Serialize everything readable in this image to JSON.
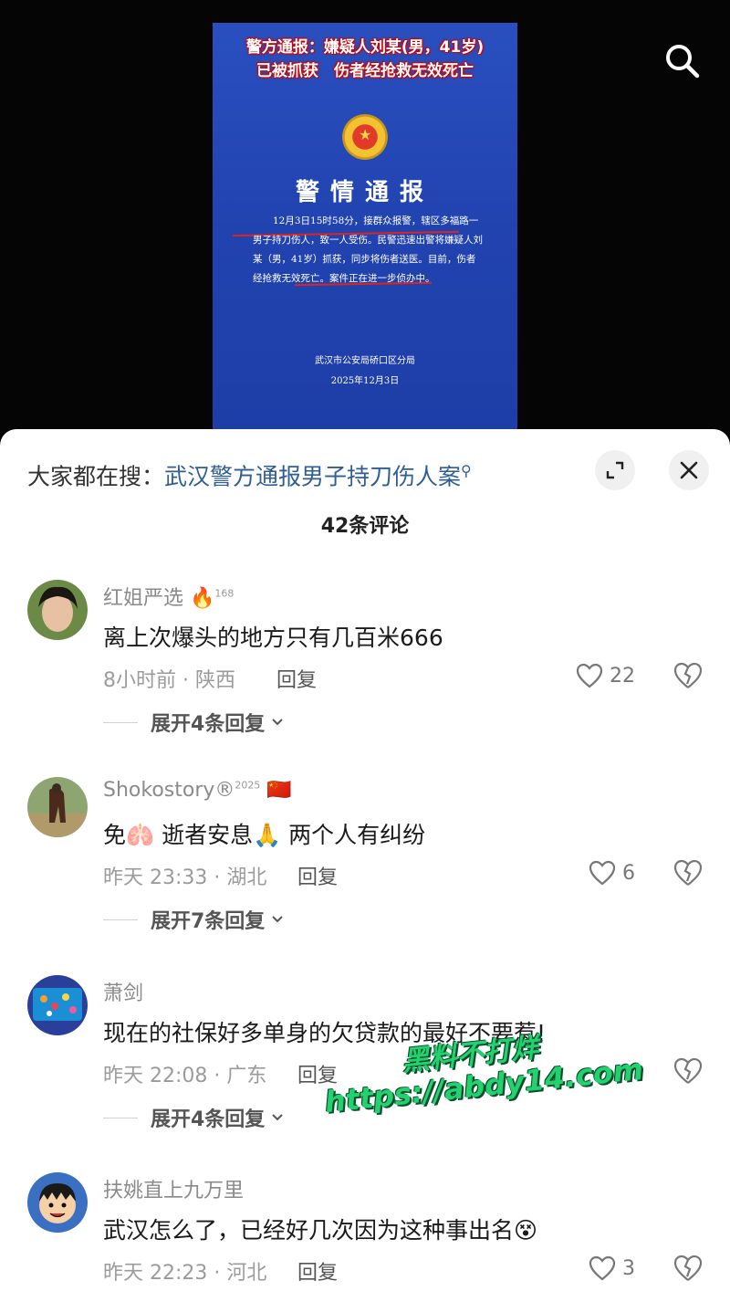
{
  "video": {
    "headline_line1": "警方通报：嫌疑人刘某(男，41岁)",
    "headline_line2": "已被抓获　伤者经抢救无效死亡",
    "notice_title": "警情通报",
    "notice_body": "12月3日15时58分，接群众报警，辖区多福路一男子持刀伤人，致一人受伤。民警迅速出警将嫌疑人刘某（男，41岁）抓获，同步将伤者送医。目前，伤者经抢救无效死亡。案件正在进一步侦办中。",
    "notice_org": "武汉市公安局硚口区分局",
    "notice_date": "2025年12月3日"
  },
  "sheet": {
    "hot_search_prefix": "大家都在搜：",
    "hot_search_term": "武汉警方通报男子持刀伤人案",
    "comment_count": "42条评论"
  },
  "comments": [
    {
      "user": "红姐严选",
      "user_badge": "🔥",
      "user_level": "168",
      "text": "离上次爆头的地方只有几百米666",
      "meta": "8小时前 · 陕西",
      "reply_label": "回复",
      "likes": "22",
      "expand": "展开4条回复"
    },
    {
      "user": "Shokostory®",
      "user_badge": "🇨🇳",
      "user_level": "2025",
      "text": "免🫁 逝者安息🙏 两个人有纠纷",
      "meta": "昨天 23:33 · 湖北",
      "reply_label": "回复",
      "likes": "6",
      "expand": "展开7条回复"
    },
    {
      "user": "萧剑",
      "user_badge": "",
      "user_level": "",
      "text": "现在的社保好多单身的欠贷款的最好不要惹!",
      "meta": "昨天 22:08 · 广东",
      "reply_label": "回复",
      "likes": "",
      "expand": "展开4条回复"
    },
    {
      "user": "扶姚直上九万里",
      "user_badge": "",
      "user_level": "",
      "text": "武汉怎么了，已经好几次因为这种事出名😵",
      "meta": "昨天 22:23 · 河北",
      "reply_label": "回复",
      "likes": "3",
      "expand": ""
    }
  ],
  "watermark": {
    "line1": "黑料不打烊",
    "line2": "https://abdy14.com"
  },
  "colors": {
    "notice_blue": "#2143b0",
    "link_blue": "#2f5d95",
    "watermark_green": "#23d26e"
  },
  "icons": [
    "search-icon",
    "expand-icon",
    "close-icon",
    "heart-icon",
    "broken-heart-icon",
    "chevron-down-icon"
  ]
}
